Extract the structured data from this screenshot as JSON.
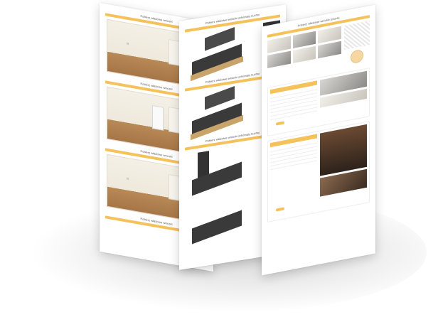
{
  "sheet1": {
    "captions": [
      "Pobierz właściwe wnioski",
      "Pobierz właściwe wnioski",
      "Pobierz właściwe wnioski",
      "Pobierz właściwe wnioski"
    ]
  },
  "sheet2": {
    "captions": [
      "Pobierz właściwe wnioski schematy kuchni",
      "Pobierz właściwe wnioski schematy kuchni",
      "Pobierz właściwe wnioski schematy kuchni"
    ]
  },
  "sheet3": {
    "captions": [
      "Pobierz właściwe wnioski rysunki"
    ],
    "button_label": ""
  }
}
